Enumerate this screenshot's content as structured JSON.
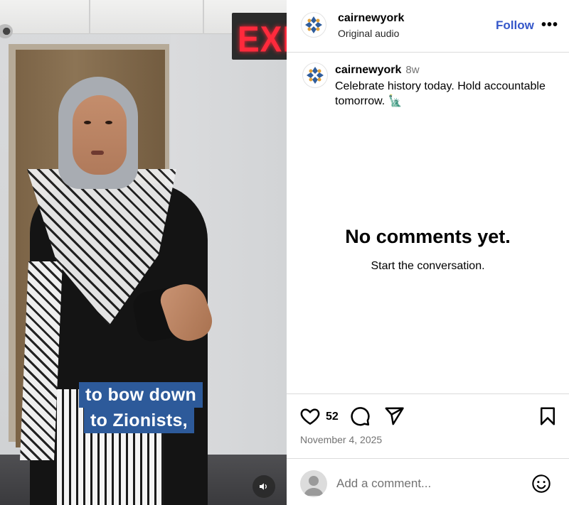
{
  "video": {
    "caption_lines": [
      "to bow down",
      "to Zionists,"
    ],
    "exit_sign": "EXIT"
  },
  "header": {
    "username": "cairnewyork",
    "audio": "Original audio",
    "follow_label": "Follow",
    "more_label": "•••"
  },
  "post": {
    "username": "cairnewyork",
    "age": "8w",
    "caption": "Celebrate history today. Hold accountable tomorrow. 🗽"
  },
  "comments": {
    "empty_title": "No comments yet.",
    "empty_subtitle": "Start the conversation."
  },
  "actions": {
    "like_count": "52",
    "date": "November 4, 2025"
  },
  "comment_box": {
    "placeholder": "Add a comment..."
  },
  "icons": [
    "like-icon",
    "comment-icon",
    "share-icon",
    "save-icon",
    "emoji-icon",
    "sound-icon"
  ],
  "colors": {
    "follow": "#3557c9",
    "caption_bg": "#2d5a9a",
    "exit_sign": "#ff2a3c"
  }
}
